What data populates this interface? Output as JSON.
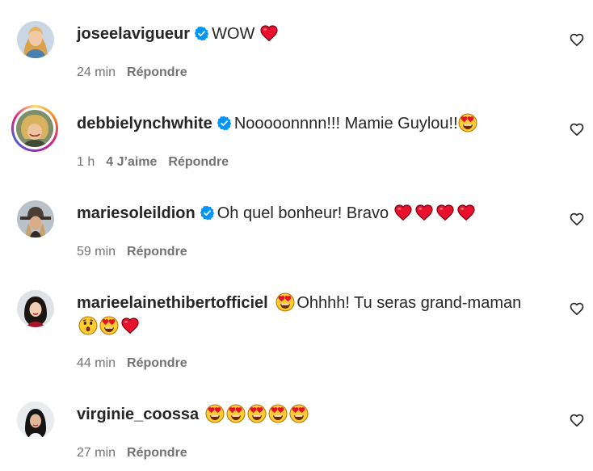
{
  "comments": [
    {
      "username": "joseelavigueur",
      "verified": true,
      "text": "WOW",
      "emojis_after": [
        "red-heart"
      ],
      "time": "24 min",
      "likes": "",
      "reply": "Répondre"
    },
    {
      "username": "debbielynchwhite",
      "verified": true,
      "text": "Nooooonnnn!!! Mamie Guylou!!",
      "emojis_after": [
        "heart-eyes"
      ],
      "time": "1 h",
      "likes": "4 J’aime",
      "reply": "Répondre"
    },
    {
      "username": "mariesoleildion",
      "verified": true,
      "text": "Oh quel bonheur! Bravo",
      "emojis_after": [
        "red-heart",
        "red-heart",
        "red-heart",
        "red-heart"
      ],
      "time": "59 min",
      "likes": "",
      "reply": "Répondre"
    },
    {
      "username": "marieelainethibertofficiel",
      "verified": false,
      "text_line1": "Ohhhh! Tu seras grand-maman",
      "emojis_before": [
        "heart-eyes"
      ],
      "emojis_line2": [
        "astonished",
        "heart-eyes",
        "red-heart"
      ],
      "time": "44 min",
      "likes": "",
      "reply": "Répondre"
    },
    {
      "username": "virginie_coossa",
      "verified": false,
      "text": "",
      "emojis_after": [
        "heart-eyes",
        "heart-eyes",
        "heart-eyes",
        "heart-eyes",
        "heart-eyes"
      ],
      "time": "27 min",
      "likes": "",
      "reply": "Répondre"
    }
  ],
  "colors": {
    "username": "#262626",
    "meta": "#737373",
    "verified": "#0095f6",
    "heart_emoji": "#e8112d",
    "story_ring": "#d62976"
  }
}
